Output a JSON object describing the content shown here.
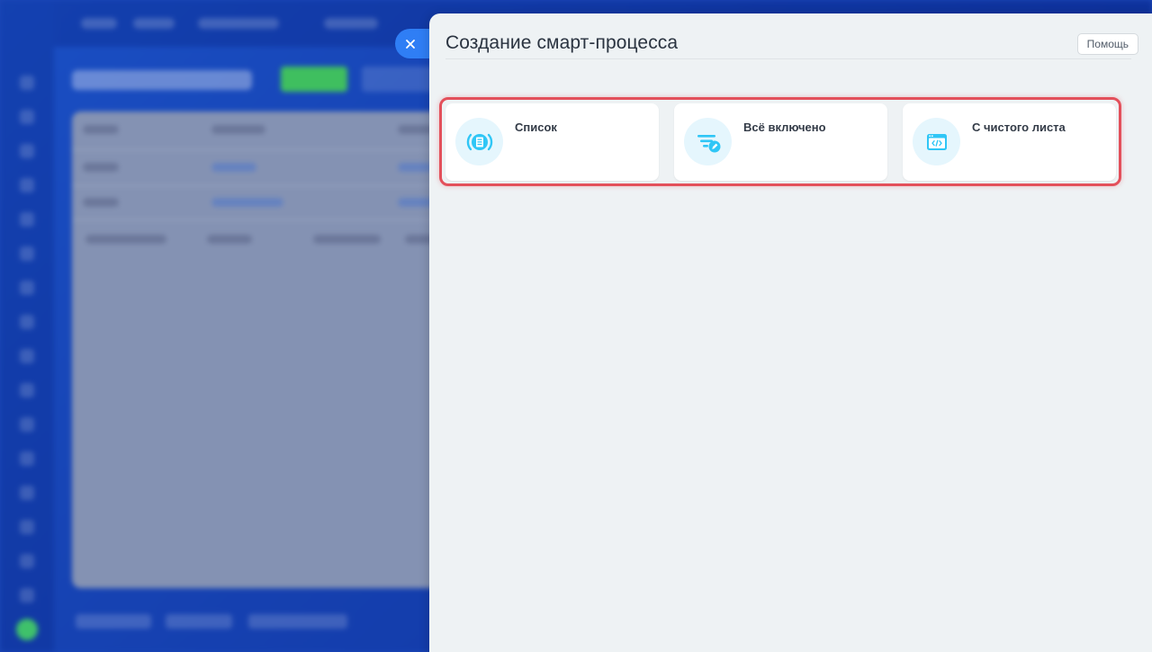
{
  "panel": {
    "title": "Создание смарт-процесса",
    "help_label": "Помощь"
  },
  "cards": [
    {
      "label": "Список",
      "icon": "list-icon"
    },
    {
      "label": "Всё включено",
      "icon": "filter-edit-icon"
    },
    {
      "label": "С чистого листа",
      "icon": "code-window-icon"
    }
  ],
  "colors": {
    "accent": "#2f7ef5",
    "icon_blue": "#2fc6f6",
    "icon_bg": "#e5f6fd",
    "highlight": "#e3505b",
    "panel_bg": "#eef2f4"
  }
}
